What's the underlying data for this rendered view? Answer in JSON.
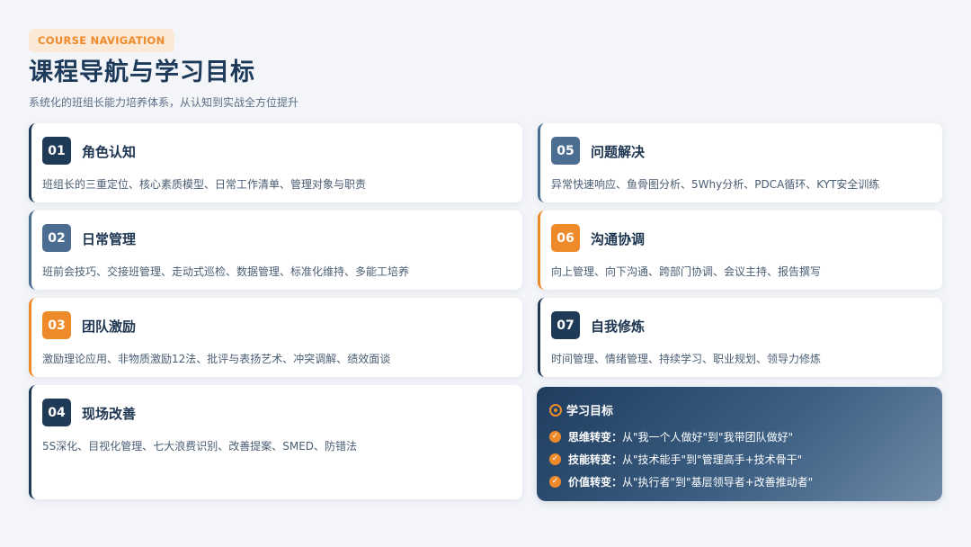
{
  "header": {
    "tag": "COURSE NAVIGATION",
    "title": "课程导航与学习目标",
    "subtitle": "系统化的班组长能力培养体系，从认知到实战全方位提升"
  },
  "modules": [
    {
      "num": "01",
      "title": "角色认知",
      "desc": "班组长的三重定位、核心素质模型、日常工作清单、管理对象与职责",
      "color": "#1f3a57"
    },
    {
      "num": "02",
      "title": "日常管理",
      "desc": "班前会技巧、交接班管理、走动式巡检、数据管理、标准化维持、多能工培养",
      "color": "#4c6d92"
    },
    {
      "num": "03",
      "title": "团队激励",
      "desc": "激励理论应用、非物质激励12法、批评与表扬艺术、冲突调解、绩效面谈",
      "color": "#ef8a2a"
    },
    {
      "num": "04",
      "title": "现场改善",
      "desc": "5S深化、目视化管理、七大浪费识别、改善提案、SMED、防错法",
      "color": "#1f3a57"
    },
    {
      "num": "05",
      "title": "问题解决",
      "desc": "异常快速响应、鱼骨图分析、5Why分析、PDCA循环、KYT安全训练",
      "color": "#4c6d92"
    },
    {
      "num": "06",
      "title": "沟通协调",
      "desc": "向上管理、向下沟通、跨部门协调、会议主持、报告撰写",
      "color": "#ef8a2a"
    },
    {
      "num": "07",
      "title": "自我修炼",
      "desc": "时间管理、情绪管理、持续学习、职业规划、领导力修炼",
      "color": "#1f3a57"
    }
  ],
  "goals": {
    "title": "学习目标",
    "items": [
      {
        "label": "思维转变：",
        "text": "从\"我一个人做好\"到\"我带团队做好\""
      },
      {
        "label": "技能转变：",
        "text": "从\"技术能手\"到\"管理高手+技术骨干\""
      },
      {
        "label": "价值转变：",
        "text": "从\"执行者\"到\"基层领导者+改善推动者\""
      }
    ]
  }
}
